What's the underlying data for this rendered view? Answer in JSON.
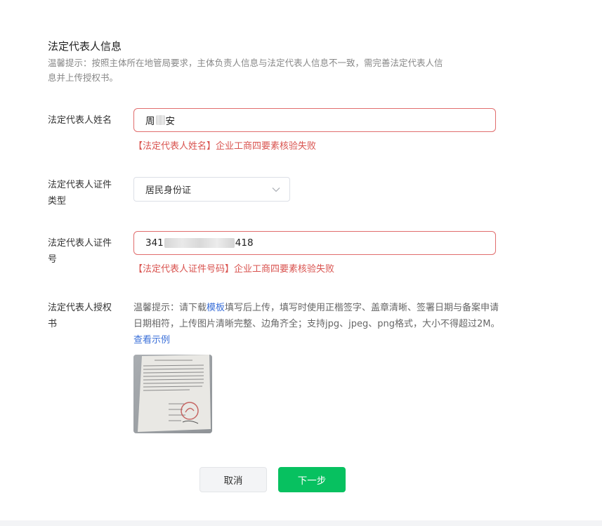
{
  "section": {
    "title": "法定代表人信息",
    "hint_line1": "温馨提示：按照主体所在地管局要求，主体负责人信息与法定代表人信息不一致，需完善法定代表人信",
    "hint_line2": "息并上传授权书。"
  },
  "name_field": {
    "label": "法定代表人姓名",
    "value_prefix": "周",
    "value_suffix": "安",
    "error": "【法定代表人姓名】企业工商四要素核验失败"
  },
  "id_type_field": {
    "label_line1": "法定代表人证件",
    "label_line2": "类型",
    "selected": "居民身份证",
    "icon": "chevron-down-icon"
  },
  "id_number_field": {
    "label_line1": "法定代表人证件",
    "label_line2": "号",
    "value_prefix": "341",
    "value_suffix": "418",
    "error": "【法定代表人证件号码】企业工商四要素核验失败"
  },
  "authorization_field": {
    "label_line1": "法定代表人授权",
    "label_line2": "书",
    "hint_prefix": "温馨提示：请下载",
    "template_link": "模板",
    "hint_middle": "填写后上传，填写时使用正楷签字、盖章清晰、签署日期与备案申请日期相符，上传图片清晰完整、边角齐全；支持jpg、jpeg、png格式，大小不得超过2M。",
    "example_link": "查看示例"
  },
  "actions": {
    "cancel_label": "取消",
    "next_label": "下一步"
  },
  "colors": {
    "error": "#d9534f",
    "error_border": "#e16d6d",
    "primary": "#07c160",
    "link": "#3a6fd8"
  }
}
